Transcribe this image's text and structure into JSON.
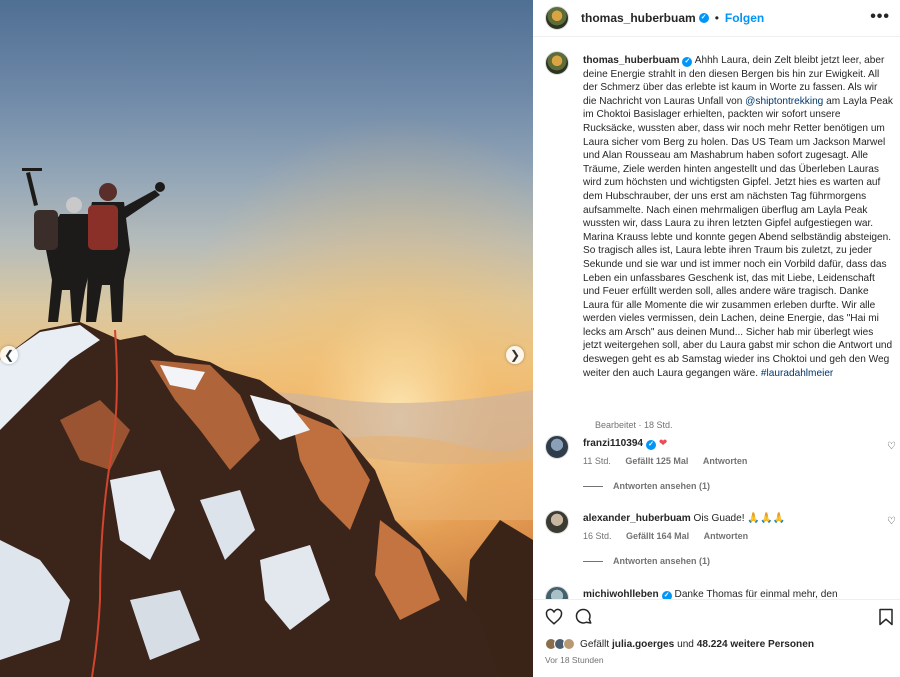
{
  "post": {
    "username": "thomas_huberbuam",
    "follow_label": "Folgen",
    "dot": "•",
    "more_label": "•••"
  },
  "caption": {
    "username": "thomas_huberbuam",
    "text_before_mention": "Ahhh Laura, dein Zelt bleibt jetzt leer, aber deine Energie strahlt in den diesen Bergen bis hin zur Ewigkeit. All der Schmerz über das erlebte ist kaum in Worte zu fassen. Als wir die Nachricht von Lauras Unfall von",
    "mention": "@shiptontrekking",
    "text_after_mention": "am Layla Peak im Choktoi Basislager erhielten, packten wir sofort unsere Rucksäcke, wussten aber, dass wir noch mehr Retter benötigen um Laura sicher vom Berg zu holen. Das US Team um Jackson Marwel und Alan Rousseau am Mashabrum haben sofort zugesagt. Alle Träume, Ziele werden hinten angestellt und das Überleben Lauras wird zum höchsten und wichtigsten Gipfel. Jetzt hies es warten auf dem Hubschrauber, der uns erst am nächsten Tag führmorgens aufsammelte. Nach einen mehrmaligen überflug am Layla Peak wussten wir, dass Laura zu ihren letzten Gipfel aufgestiegen war. Marina Krauss lebte und konnte gegen Abend selbständig absteigen. So tragisch alles ist, Laura lebte ihren Traum bis zuletzt, zu jeder Sekunde und sie war und ist immer noch ein Vorbild dafür, dass das Leben ein unfassbares Geschenk ist, das mit Liebe, Leidenschaft und Feuer erfüllt werden soll, alles andere wäre tragisch. Danke Laura für alle Momente die wir zusammen erleben durfte. Wir alle werden vieles vermissen, dein Lachen, deine Energie, das \"Hai mi lecks am Arsch\" aus deinen Mund... Sicher hab mir überlegt wies jetzt weitergehen soll, aber du Laura gabst mir schon die Antwort und deswegen geht es ab Samstag wieder ins Choktoi und geh den Weg weiter den auch Laura gegangen wäre.",
    "hashtag": "#lauradahlmeier",
    "meta": "Bearbeitet · 18 Std."
  },
  "comments": [
    {
      "username": "franzi110394",
      "verified": true,
      "text": "",
      "emoji": "❤",
      "time": "11 Std.",
      "likes": "Gefällt 125 Mal",
      "reply_label": "Antworten",
      "view_replies": "Antworten ansehen (1)"
    },
    {
      "username": "alexander_huberbuam",
      "verified": false,
      "text": "Ois Guade!",
      "emoji": "🙏🙏🙏",
      "time": "16 Std.",
      "likes": "Gefällt 164 Mal",
      "reply_label": "Antworten",
      "view_replies": "Antworten ansehen (1)"
    },
    {
      "username": "michiwohlleben",
      "verified": true,
      "text": "Danke Thomas für einmal mehr, den"
    }
  ],
  "footer": {
    "liked_prefix": "Gefällt",
    "liked_user": "julia.goerges",
    "liked_connector": "und",
    "liked_others": "48.224 weitere Personen",
    "time_ago": "Vor 18 Stunden"
  },
  "icons": {
    "heart": "heart-icon",
    "comment": "comment-icon",
    "bookmark": "bookmark-icon",
    "verified": "verified-badge-icon",
    "prev": "chevron-left-icon",
    "next": "chevron-right-icon"
  },
  "colors": {
    "accent_blue": "#0095f6",
    "link_blue": "#00376b",
    "muted": "#737373",
    "heart_red": "#ed4956"
  }
}
